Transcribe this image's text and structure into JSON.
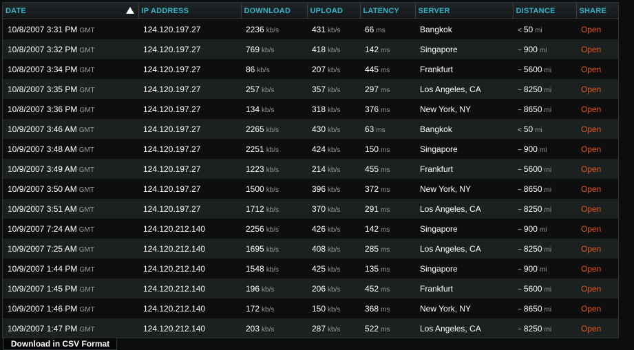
{
  "columns": [
    {
      "key": "date",
      "label": "DATE"
    },
    {
      "key": "ip",
      "label": "IP ADDRESS"
    },
    {
      "key": "download",
      "label": "DOWNLOAD"
    },
    {
      "key": "upload",
      "label": "UPLOAD"
    },
    {
      "key": "latency",
      "label": "LATENCY"
    },
    {
      "key": "server",
      "label": "SERVER"
    },
    {
      "key": "distance",
      "label": "DISTANCE"
    },
    {
      "key": "share",
      "label": "SHARE"
    }
  ],
  "sort_icon": "sort-ascending-icon",
  "units": {
    "tz": "GMT",
    "speed": "kb/s",
    "latency": "ms",
    "distance": "mi"
  },
  "share_label": "Open",
  "colors": {
    "header_text": "#33b6c9",
    "link": "#e45a1e",
    "row_alt": "#1b2020"
  },
  "rows": [
    {
      "date": "10/8/2007 3:31 PM",
      "ip": "124.120.197.27",
      "download": "2236",
      "upload": "431",
      "latency": "66",
      "server": "Bangkok",
      "approx": "<",
      "distance": "50"
    },
    {
      "date": "10/8/2007 3:32 PM",
      "ip": "124.120.197.27",
      "download": "769",
      "upload": "418",
      "latency": "142",
      "server": "Singapore",
      "approx": "~",
      "distance": "900"
    },
    {
      "date": "10/8/2007 3:34 PM",
      "ip": "124.120.197.27",
      "download": "86",
      "upload": "207",
      "latency": "445",
      "server": "Frankfurt",
      "approx": "~",
      "distance": "5600"
    },
    {
      "date": "10/8/2007 3:35 PM",
      "ip": "124.120.197.27",
      "download": "257",
      "upload": "357",
      "latency": "297",
      "server": "Los Angeles, CA",
      "approx": "~",
      "distance": "8250"
    },
    {
      "date": "10/8/2007 3:36 PM",
      "ip": "124.120.197.27",
      "download": "134",
      "upload": "318",
      "latency": "376",
      "server": "New York, NY",
      "approx": "~",
      "distance": "8650"
    },
    {
      "date": "10/9/2007 3:46 AM",
      "ip": "124.120.197.27",
      "download": "2265",
      "upload": "430",
      "latency": "63",
      "server": "Bangkok",
      "approx": "<",
      "distance": "50"
    },
    {
      "date": "10/9/2007 3:48 AM",
      "ip": "124.120.197.27",
      "download": "2251",
      "upload": "424",
      "latency": "150",
      "server": "Singapore",
      "approx": "~",
      "distance": "900"
    },
    {
      "date": "10/9/2007 3:49 AM",
      "ip": "124.120.197.27",
      "download": "1223",
      "upload": "214",
      "latency": "455",
      "server": "Frankfurt",
      "approx": "~",
      "distance": "5600"
    },
    {
      "date": "10/9/2007 3:50 AM",
      "ip": "124.120.197.27",
      "download": "1500",
      "upload": "396",
      "latency": "372",
      "server": "New York, NY",
      "approx": "~",
      "distance": "8650"
    },
    {
      "date": "10/9/2007 3:51 AM",
      "ip": "124.120.197.27",
      "download": "1712",
      "upload": "370",
      "latency": "291",
      "server": "Los Angeles, CA",
      "approx": "~",
      "distance": "8250"
    },
    {
      "date": "10/9/2007 7:24 AM",
      "ip": "124.120.212.140",
      "download": "2256",
      "upload": "426",
      "latency": "142",
      "server": "Singapore",
      "approx": "~",
      "distance": "900"
    },
    {
      "date": "10/9/2007 7:25 AM",
      "ip": "124.120.212.140",
      "download": "1695",
      "upload": "408",
      "latency": "285",
      "server": "Los Angeles, CA",
      "approx": "~",
      "distance": "8250"
    },
    {
      "date": "10/9/2007 1:44 PM",
      "ip": "124.120.212.140",
      "download": "1548",
      "upload": "425",
      "latency": "135",
      "server": "Singapore",
      "approx": "~",
      "distance": "900"
    },
    {
      "date": "10/9/2007 1:45 PM",
      "ip": "124.120.212.140",
      "download": "196",
      "upload": "206",
      "latency": "452",
      "server": "Frankfurt",
      "approx": "~",
      "distance": "5600"
    },
    {
      "date": "10/9/2007 1:46 PM",
      "ip": "124.120.212.140",
      "download": "172",
      "upload": "150",
      "latency": "368",
      "server": "New York, NY",
      "approx": "~",
      "distance": "8650"
    },
    {
      "date": "10/9/2007 1:47 PM",
      "ip": "124.120.212.140",
      "download": "203",
      "upload": "287",
      "latency": "522",
      "server": "Los Angeles, CA",
      "approx": "~",
      "distance": "8250"
    }
  ],
  "footer": {
    "csv_label": "Download in CSV Format"
  }
}
